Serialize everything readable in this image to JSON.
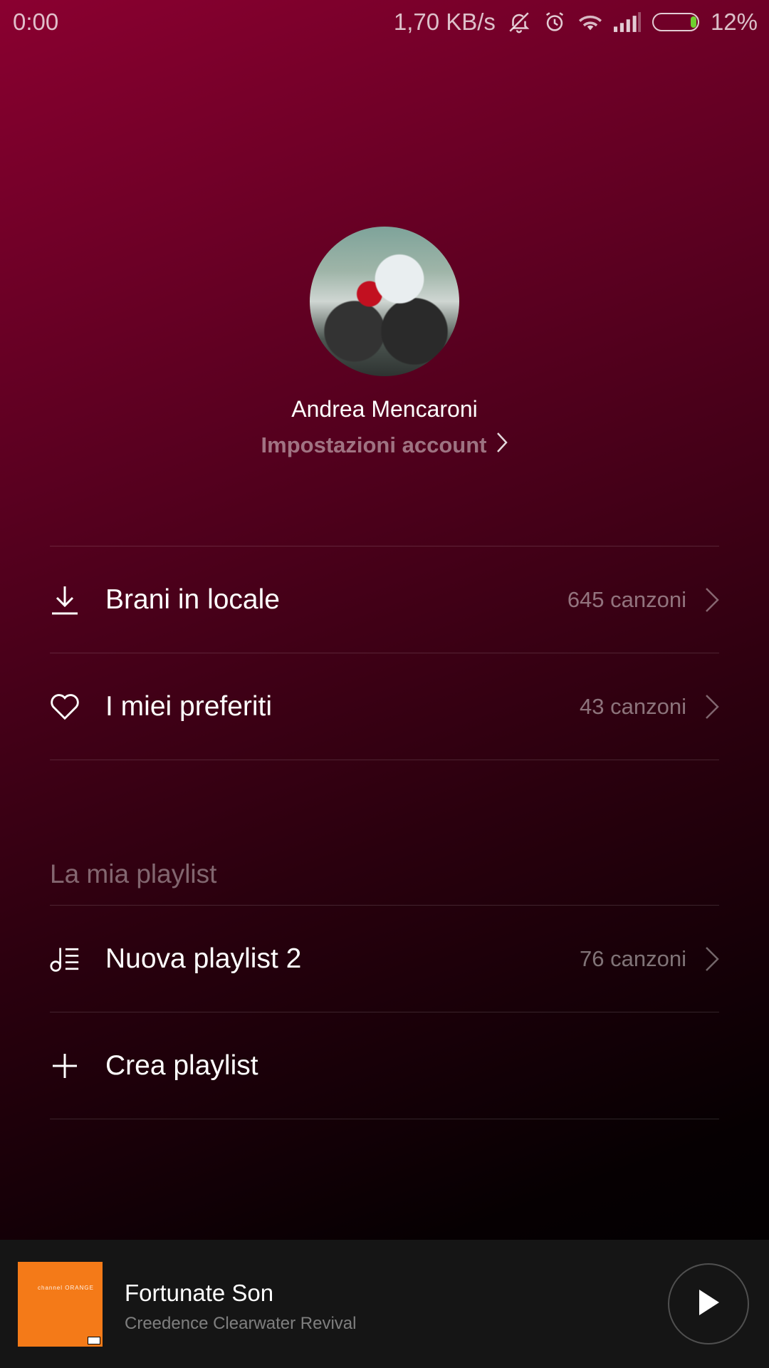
{
  "status_bar": {
    "time": "0:00",
    "speed": "1,70 KB/s",
    "battery_percent": "12%",
    "battery_level": 0.12,
    "icons": [
      "notifications-off-icon",
      "alarm-icon",
      "wifi-icon",
      "signal-icon",
      "battery-icon"
    ]
  },
  "profile": {
    "name": "Andrea Mencaroni",
    "account_settings_label": "Impostazioni account"
  },
  "library": [
    {
      "icon": "download-icon",
      "label": "Brani in locale",
      "count": "645 canzoni"
    },
    {
      "icon": "heart-icon",
      "label": "I miei preferiti",
      "count": "43 canzoni"
    }
  ],
  "playlists_section": {
    "title": "La mia playlist",
    "items": [
      {
        "icon": "playlist-icon",
        "label": "Nuova playlist 2",
        "count": "76 canzoni"
      },
      {
        "icon": "plus-icon",
        "label": "Crea playlist"
      }
    ]
  },
  "now_playing": {
    "title": "Fortunate Son",
    "artist": "Creedence Clearwater Revival",
    "album_art_text": "channel ORANGE"
  },
  "colors": {
    "accent": "#8a0030",
    "player_bg": "#151515",
    "album_art": "#f47a18",
    "battery_fill": "#6fd12f"
  }
}
